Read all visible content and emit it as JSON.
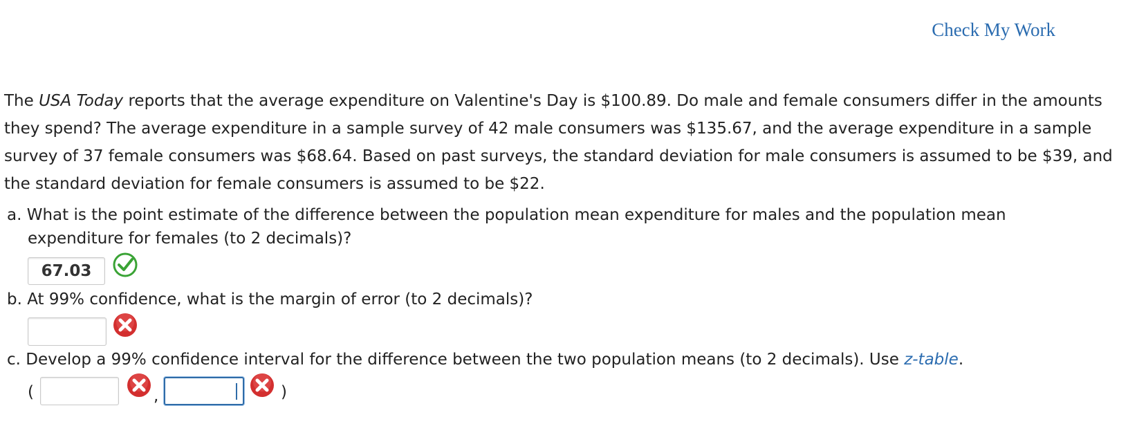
{
  "header": {
    "check_my_work": "Check My Work"
  },
  "problem": {
    "intro_before_italic": "The ",
    "intro_italic": "USA Today",
    "intro_after_italic": " reports that the average expenditure on Valentine's Day is $100.89. Do male and female consumers differ in the amounts they spend? The average expenditure in a sample survey of 42 male consumers was $135.67, and the average expenditure in a sample survey of 37 female consumers was $68.64. Based on past surveys, the standard deviation for male consumers is assumed to be $39, and the standard deviation for female consumers is assumed to be $22."
  },
  "questions": {
    "a": {
      "line1": "a. What is the point estimate of the difference between the population mean expenditure for males and the population mean",
      "line2": "expenditure for females (to 2 decimals)?",
      "answer": "67.03",
      "status": "correct"
    },
    "b": {
      "text": "b. At 99% confidence, what is the margin of error (to 2 decimals)?",
      "answer": "",
      "status": "incorrect"
    },
    "c": {
      "text_before_link": "c. Develop a 99% confidence interval for the difference between the two population means (to 2 decimals). Use ",
      "link": "z-table",
      "text_after_link": ".",
      "open_paren": "(",
      "comma": ",",
      "close_paren": ")",
      "lower": "",
      "upper": "",
      "lower_status": "incorrect",
      "upper_status": "incorrect"
    }
  },
  "colors": {
    "correct": "#3aa335",
    "incorrect": "#d32f2f",
    "link": "#2b6cb0"
  }
}
